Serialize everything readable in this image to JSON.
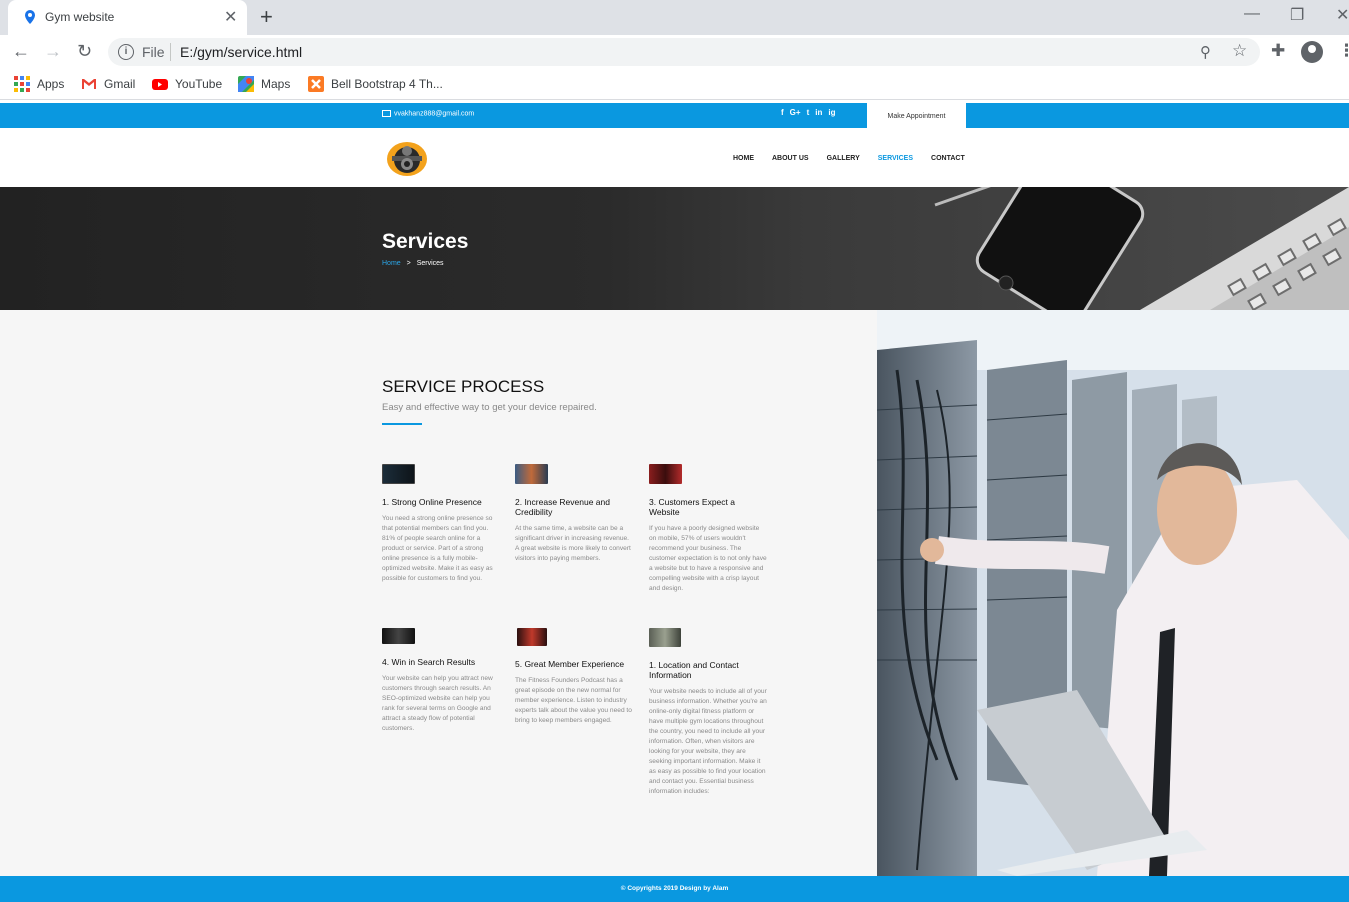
{
  "browser": {
    "tab_title": "Gym website",
    "close_glyph": "✕",
    "new_tab_glyph": "+",
    "url_scheme": "File",
    "url": "E:/gym/service.html",
    "bookmarks": [
      {
        "label": "Apps",
        "icon": "apps-grid-icon"
      },
      {
        "label": "Gmail",
        "icon": "gmail-icon"
      },
      {
        "label": "YouTube",
        "icon": "youtube-icon"
      },
      {
        "label": "Maps",
        "icon": "maps-icon"
      },
      {
        "label": "Bell Bootstrap 4 Th...",
        "icon": "xampp-icon"
      }
    ]
  },
  "topbar": {
    "email": "vvakhanz888@gmail.com",
    "social": [
      "f",
      "G+",
      "t",
      "in",
      "ig"
    ],
    "appointment_label": "Make Appointment"
  },
  "nav": {
    "items": [
      "HOME",
      "ABOUT US",
      "GALLERY",
      "SERVICES",
      "CONTACT"
    ],
    "active": "SERVICES"
  },
  "banner": {
    "title": "Services",
    "breadcrumb_home": "Home",
    "breadcrumb_sep": ">",
    "breadcrumb_current": "Services"
  },
  "section": {
    "title": "SERVICE PROCESS",
    "subtitle": "Easy and effective way to get your device repaired.",
    "items": [
      {
        "title": "1. Strong Online Presence",
        "desc": "You need a strong online presence so that potential members can find you. 81% of people search online for a product or service. Part of a strong online presence is a fully mobile-optimized website. Make it as easy as possible for customers to find you."
      },
      {
        "title": "2. Increase Revenue and Credibility",
        "desc": "At the same time, a website can be a significant driver in increasing revenue. A great website is more likely to convert visitors into paying members."
      },
      {
        "title": "3. Customers Expect a Website",
        "desc": "If you have a poorly designed website on mobile, 57% of users wouldn't recommend your business. The customer expectation is to not only have a website but to have a responsive and compelling website with a crisp layout and design."
      },
      {
        "title": "4. Win in Search Results",
        "desc": "Your website can help you attract new customers through search results. An SEO-optimized website can help you rank for several terms on Google and attract a steady flow of potential customers."
      },
      {
        "title": "5. Great Member Experience",
        "desc": "The Fitness Founders Podcast has a great episode on the new normal for member experience. Listen to industry experts talk about the value you need to bring to keep members engaged."
      },
      {
        "title": "1. Location and Contact Information",
        "desc": "Your website needs to include all of your business information. Whether you're an online-only digital fitness platform or have multiple gym locations throughout the country, you need to include all your information. Often, when visitors are looking for your website, they are seeking important information. Make it as easy as possible to find your location and contact you. Essential business information includes:"
      }
    ]
  },
  "footer": {
    "copyright": "© Copyrights 2019 Design by Alam"
  },
  "colors": {
    "brand_blue": "#0a98e0",
    "content_bg": "#f6f6f6"
  }
}
